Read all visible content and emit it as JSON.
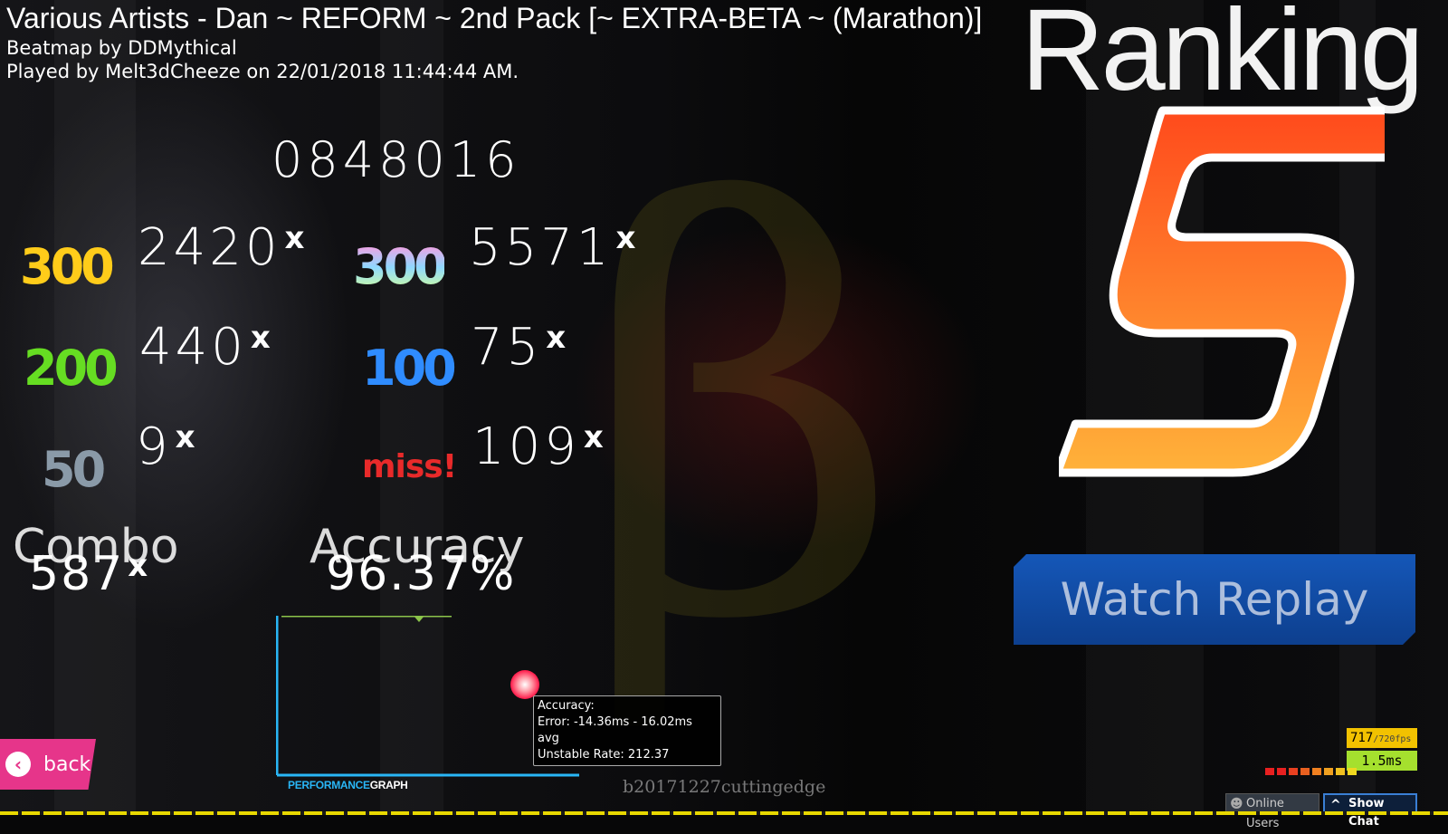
{
  "header": {
    "title": "Various Artists - Dan ~ REFORM ~ 2nd Pack [~ EXTRA-BETA ~ (Marathon)]",
    "beatmap_by": "Beatmap by DDMythical",
    "played_by": "Played by Melt3dCheeze on 22/01/2018 11:44:44 AM."
  },
  "ranking": {
    "heading": "Ranking",
    "grade": "S",
    "grade_colors": [
      "#ff4a1c",
      "#ffb23a"
    ]
  },
  "score": "0848016",
  "hits": [
    {
      "label": "300",
      "count": "2420",
      "color": "#ffcc1a"
    },
    {
      "label": "300",
      "count": "5571",
      "color": "rainbow"
    },
    {
      "label": "200",
      "count": "440",
      "color": "#66dd22"
    },
    {
      "label": "100",
      "count": "75",
      "color": "#2f8cff"
    },
    {
      "label": "50",
      "count": "9",
      "color": "#8a9aa8"
    },
    {
      "label": "miss!",
      "count": "109",
      "color": "#e82a2a"
    }
  ],
  "multiplier_suffix": "x",
  "combo": {
    "label": "Combo",
    "value": "587",
    "suffix": "x"
  },
  "accuracy": {
    "label": "Accuracy",
    "value": "96.37%"
  },
  "watch_replay": {
    "label": "Watch Replay"
  },
  "back": {
    "label": "back",
    "icon": "chevron-left-icon"
  },
  "performance_graph": {
    "label_left": "PERFORMANCE",
    "label_right": "GRAPH",
    "color": "#29b6f6"
  },
  "tooltip": {
    "line1": "Accuracy:",
    "line2": "Error: -14.36ms - 16.02ms avg",
    "line3": "Unstable Rate: 212.37"
  },
  "build": "b20171227cuttingedge",
  "fps": {
    "value": "717",
    "max": "/720fps"
  },
  "frametime": "1.5ms",
  "online_users": {
    "label": "Online Users",
    "icon": "users-icon"
  },
  "show_chat": {
    "label": "Show Chat",
    "icon": "caret-up-icon"
  }
}
